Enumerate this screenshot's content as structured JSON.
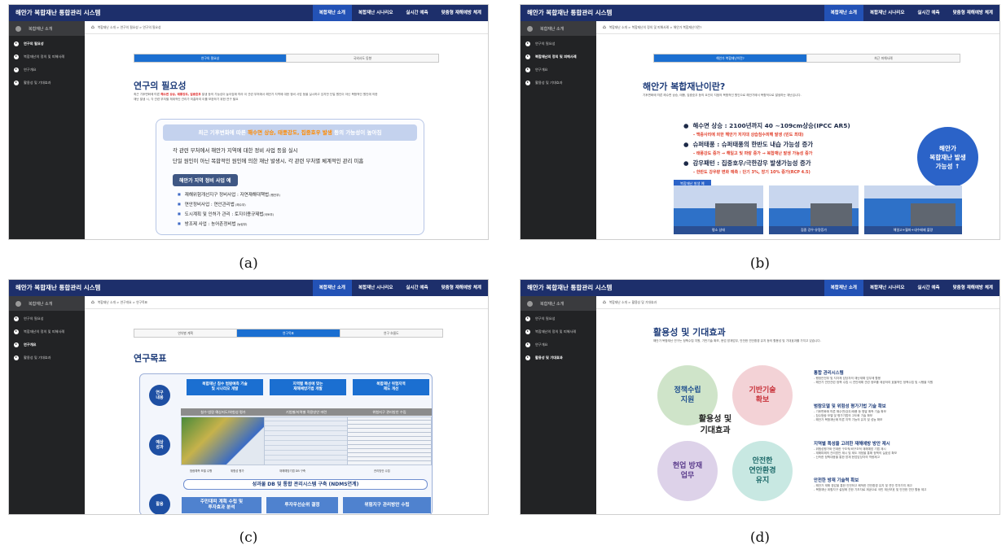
{
  "app": {
    "brand": "해안가 복합재난 통합관리 시스템",
    "nav": [
      "복합재난 소개",
      "복합재난 시나리오",
      "실시간 예측",
      "맞춤형 재해예방 체계"
    ],
    "sidebar_head": "복합재난 소개",
    "sidebar_items": [
      "연구의 필요성",
      "복합재난의 정의 및 피해사례",
      "연구개요",
      "활용성 및 기대효과"
    ]
  },
  "captions": {
    "a": "(a)",
    "b": "(b)",
    "c": "(c)",
    "d": "(d)"
  },
  "panel_a": {
    "crumb": "복합재난 소개 > 연구의 필요성 > 연구의 필요성",
    "tabs": [
      "연구의 필요성",
      "국외사도 동향"
    ],
    "title": "연구의 필요성",
    "intro_pre": "최근 기후변화에 따른 ",
    "intro_red": "해수면 상승, 태풍강도, 집중호우",
    "intro_post": " 발생 등의 가능성이 높아짐에 따라 이 관련 부처에서 해안가 지역에 대한 정비 사업 등을 실시하고 있지만 단일 원인이 아닌 복합적인 원인에 의한 재난 발생 시, 각 관련 부처별 체계적인 관리가 미흡하여 이를 보완하기 위한 연구 필요",
    "band_pre": "최근 기후변화에 따른 ",
    "band_orange": "해수면 상승, 태풍강도, 집중호우 발생",
    "band_post": " 등의 가능성이 높아짐",
    "line1": "각 관련 부처에서 해안가 지역에 대한 정비 사업 등을 실시",
    "line2": "단일 원인이 아닌 복합적인 원인에 의한 재난 발생시, 각 관련 부처별 체계적인 관리 미흡",
    "pill": "해안가 지역 정비 사업 예",
    "items": [
      {
        "main": "재해위험개선지구 정비사업 : 자연재해대책법",
        "sm": " (행안부)"
      },
      {
        "main": "연안정비사업 : 연안관리법",
        "sm": " (해수부)"
      },
      {
        "main": "도시계획 및 인허가 관리 : 토지이용규제법",
        "sm": "(국토부)"
      },
      {
        "main": "방조제 사업 : 농어촌정비법",
        "sm": " (농림부)"
      }
    ]
  },
  "panel_b": {
    "crumb": "복합재난 소개 > 복합재난의 정의 및 피해사례 > 해안가 복합재난이란?",
    "tabs": [
      "해안가 복합재난이란?",
      "최근 피해사례"
    ],
    "title": "해안가 복합재난이란?",
    "intro": "기후변화에 따른 해수면 상승, 태풍, 집중호우 등의 요인이 지점의 복합적인 원인으로 해안가에서 복합적으로 발생하는 재난입니다.",
    "bullets": [
      {
        "main": "해수면 상승 : 2100년까지 40 ~109cm상승(IPCC AR5)",
        "sub": "- 백중사리에 의한 해안가 저지대 상습침수피해 발생 (빈도 최대)"
      },
      {
        "main": "슈퍼태풍    : 슈퍼태풍의 한반도 내습 가능성 증가",
        "sub": "- 태풍강도 증가 → 해일고 및 파랑 증가 → 복합재난 발생 가능성 증가"
      },
      {
        "main": "강우패턴    : 집중호우/극한강우  발생가능성 증가",
        "sub": "- 한반도 강우량 변화 예측 : 단기 3%, 장기 10% 증가(RCP 4.5)"
      }
    ],
    "circle": [
      "해안가",
      "복합재난 발생",
      "가능성 ↑"
    ],
    "tag": "복합재난 발생 예",
    "scenes": [
      "평소 상태",
      "집중 강우·유량증가",
      "해일고+월파+내수배제 불량"
    ]
  },
  "panel_c": {
    "crumb": "복합재난 소개 > 연구개요 > 연구목표",
    "tabs": [
      "연차별 계획",
      "연구목표",
      "연구 흐름도"
    ],
    "title": "연구목표",
    "row_labels": [
      "연구\n내용",
      "예상\n성과",
      "활용"
    ],
    "heads": [
      "복합재난 침수 범람예측 기술\n및 시나리오 개발",
      "지역별 특성에 맞는\n재해예방기법 개발",
      "복합재난 위험지역\n제도 개선"
    ],
    "subs": [
      "침수·범람 예상지도/위험성 평가",
      "기법별/지역별 적용방안 마련",
      "위험지구 관리방안 수립"
    ],
    "labels": [
      "범람예측 모델 수행",
      "위험성 평가",
      "재해예방기법 DB 구축",
      "관리방안 수립"
    ],
    "db": "성과물 DB 및 통합 관리시스템 구축 (NDMS연계)",
    "arrows": [
      "주민대피 계획 수립 및\n투자효과 분석",
      "투자우선순위 결정",
      "위험지구 관리방안 수립"
    ]
  },
  "panel_d": {
    "crumb": "복합재난 소개 > 활용성 및 기대효과",
    "title": "활용성 및 기대효과",
    "intro": "해안가 복합재난 연구는 정책수립 지원, 기반기술 확보, 현업 방재업무, 안전한 연안환경 유지 등의 활용성 및 기대효과를 가지고 있습니다.",
    "circles": [
      "정책수립\n지원",
      "기반기술\n확보",
      "현업 방재\n업무",
      "안전한\n연안환경\n유지"
    ],
    "center": "활용성 및\n기대효과",
    "sections": [
      {
        "t": "통합 관리시스템",
        "s": "- 행정안전부 및 지자체 담당자의 재난재해 업무에 활용\n- 해안가 연안관련 정책 수립 시 연안재해 관련 정보를 제공하여 효율적인 정책수립 및 시행을 지원"
      },
      {
        "t": "범람모델 및 위험성 평가기법 기술 확보",
        "s": "- 기후변화에 따른 해수면/강우/태풍 등 명발 예측 기술 확보\n- 침수범람 모델 및 평가기법의 고도화 기술 확보\n- 해안가 복합재난에 따른 지역 기능의 유지 및 성능 확보"
      },
      {
        "t": "지역별 특성을 고려한 재해예방 방안 제시",
        "s": "- 위험성평가와 연계한 구조적/비구조적 재해예방 기법 제시\n- 재해피해의 관리방안 제시 및 제도 개정을 통해 정책의 실효성 확보\n- 신속한 정책대응을 통한 방재 현업담당자의 역량제고"
      },
      {
        "t": "안전한 방재 기술력 확보",
        "s": "- 해안가 재해 경감을 통한 안전하고 쾌적한 연안환경 유지 및 연안 투자가치 제고\n- 복합재난 위험지구 설정에 관한 기초자료 제공으로 국민 재산보호 및 안전한 연안 활동 제고"
      }
    ]
  },
  "colors": {
    "topbar": "#1d2f6b",
    "accent": "#1b6fd1",
    "sidebar": "#222325",
    "circle_green": "#cfe4c9",
    "circle_pink": "#f3d2d6",
    "circle_purple": "#ddd2e9",
    "circle_teal": "#c8e8e2"
  }
}
